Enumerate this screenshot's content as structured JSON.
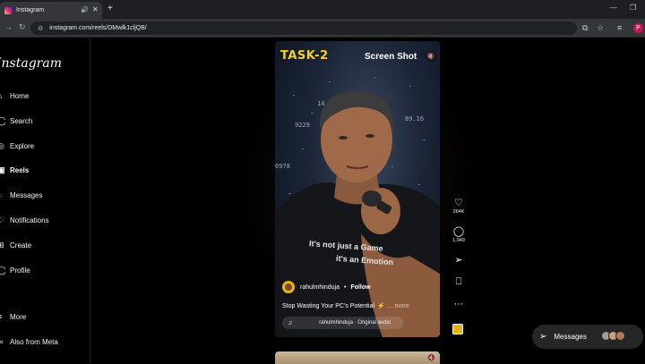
{
  "browser": {
    "tab_title": "Instagram",
    "new_tab": "+",
    "url": "instagram.com/reels/DMwlk1cljQB/",
    "profile_initial": "P"
  },
  "sidebar": {
    "logo": "Instagram",
    "items": [
      {
        "label": "Home",
        "icon": "home-icon"
      },
      {
        "label": "Search",
        "icon": "search-icon"
      },
      {
        "label": "Explore",
        "icon": "compass-icon"
      },
      {
        "label": "Reels",
        "icon": "reels-icon",
        "active": true
      },
      {
        "label": "Messages",
        "icon": "messenger-icon"
      },
      {
        "label": "Notifications",
        "icon": "heart-icon"
      },
      {
        "label": "Create",
        "icon": "plus-square-icon"
      },
      {
        "label": "Profile",
        "icon": "profile-icon"
      },
      {
        "label": "More",
        "icon": "menu-icon"
      },
      {
        "label": "Also from Meta",
        "icon": "meta-icon"
      }
    ]
  },
  "reel": {
    "overlay_title": "TASK-2",
    "overlay_subtitle": "Screen Shot",
    "bg_numbers": [
      "14",
      "89.16",
      "9229",
      "6978"
    ],
    "tee_line1": "It's not just a Game",
    "tee_line2": "it's an Emotion",
    "author": "rahulmhinduja",
    "separator": "•",
    "follow_label": "Follow",
    "caption": "Stop Wasting Your PC's Potential",
    "more_label": "... more",
    "audio": "rahulmhinduja · Original audio"
  },
  "actions": {
    "likes": "264K",
    "comments": "1,049"
  },
  "messages": {
    "label": "Messages"
  },
  "colors": {
    "task_yellow": "#f2d22a",
    "background": "#000000",
    "accent_avatar": "#e6b419"
  }
}
